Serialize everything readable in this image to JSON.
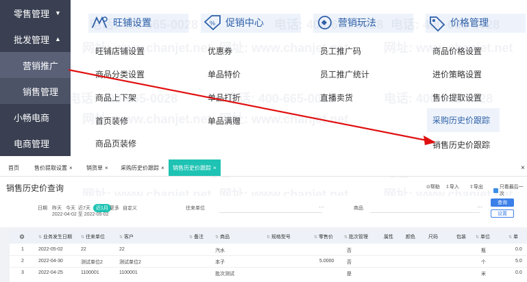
{
  "leftnav": {
    "retail": "零售管理",
    "wholesale": "批发管理",
    "marketing_promo": "营销推广",
    "sales_mgmt": "销售管理",
    "xiaochang": "小畅电商",
    "ecommerce": "电商管理"
  },
  "menu": {
    "categories": [
      {
        "label": "旺铺设置",
        "icon": "shop-settings-icon"
      },
      {
        "label": "促销中心",
        "icon": "promotion-icon"
      },
      {
        "label": "营销玩法",
        "icon": "marketing-play-icon"
      },
      {
        "label": "价格管理",
        "icon": "price-management-icon"
      }
    ],
    "col1": [
      "旺铺店铺设置",
      "商品分类设置",
      "商品上下架",
      "首页装修",
      "商品页装修"
    ],
    "col2": [
      "优惠券",
      "单品特价",
      "单品打折",
      "单品满赠"
    ],
    "col3": [
      "员工推广码",
      "员工推广统计",
      "直播卖货"
    ],
    "col4": [
      "商品价格设置",
      "进价策略设置",
      "售价提取设置",
      "采购历史价跟踪",
      "销售历史价跟踪"
    ]
  },
  "watermark": {
    "phone": "电话: 400-665-0028",
    "site": "网址: www.chanjet.net"
  },
  "tabs": [
    {
      "label": "首页"
    },
    {
      "label": "售价提取设置"
    },
    {
      "label": "销货单"
    },
    {
      "label": "采购历史价跟踪"
    },
    {
      "label": "销售历史价跟踪"
    }
  ],
  "tab_close": "×",
  "window_close": "×",
  "page": {
    "title": "销售历史价查询",
    "toolbar": {
      "help": "帮助",
      "import": "导入",
      "export": "导出",
      "latest_only": "只看最后一次"
    }
  },
  "filter": {
    "date_label": "日期",
    "date_options": [
      "昨天",
      "今天",
      "近7天",
      "近1月",
      "更多",
      "自定义"
    ],
    "date_selected": "近1月",
    "date_range": "2022-04-02 至 2022-05-02",
    "partner_label": "往来单位",
    "product_label": "商品",
    "dots": "···",
    "query_btn": "查询",
    "settings_btn": "设置"
  },
  "table": {
    "columns": [
      "业务发生日期",
      "往来单位",
      "客户",
      "备注",
      "商品",
      "规格型号",
      "零售价",
      "批次管理",
      "属性",
      "颜色",
      "尺码",
      "包装",
      "单位"
    ],
    "rows": [
      {
        "no": "1",
        "date": "2022-05-02",
        "partner": "22",
        "customer": "22",
        "product": "汽水",
        "price": "",
        "batch": "否",
        "unit": "瓶",
        "amount": "0.0"
      },
      {
        "no": "2",
        "date": "2022-04-30",
        "partner": "测试单位2",
        "customer": "测试单位2",
        "product": "本子",
        "price": "5.0000",
        "batch": "否",
        "unit": "个",
        "amount": "5.0"
      },
      {
        "no": "3",
        "date": "2022-04-25",
        "partner": "1100001",
        "customer": "1100001",
        "product": "批次测试",
        "price": "",
        "batch": "是",
        "unit": "米",
        "amount": "0.0"
      }
    ],
    "extra_col": "单"
  },
  "colors": {
    "nav_bg": "#3a4052",
    "accent": "#1ec3b3",
    "link": "#2c5fa8",
    "arrow": "#e01010",
    "button": "#3b7fe8"
  }
}
